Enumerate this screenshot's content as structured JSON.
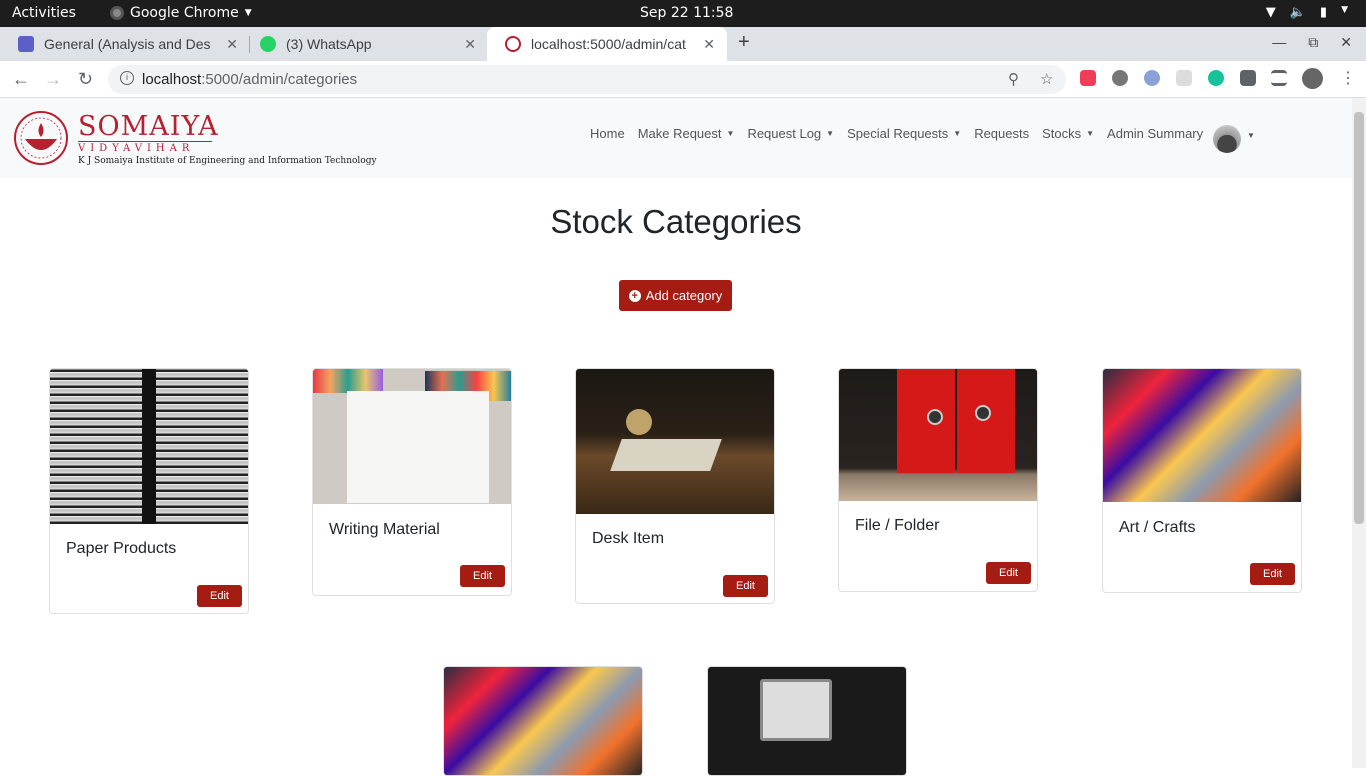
{
  "os": {
    "activities": "Activities",
    "app_name": "Google Chrome",
    "clock": "Sep 22  11:58"
  },
  "browser": {
    "tabs": [
      {
        "title": "General (Analysis and Des",
        "icon": "teams-icon",
        "color": "#5b5fc7"
      },
      {
        "title": "(3) WhatsApp",
        "icon": "whatsapp-icon",
        "color": "#25d366"
      },
      {
        "title": "localhost:5000/admin/cat",
        "icon": "somaiya-favicon",
        "color": "#b7202e"
      }
    ],
    "url_host": "localhost",
    "url_rest": ":5000/admin/categories"
  },
  "navbar": {
    "brand": "SOMAIYA",
    "brand_sub": "VIDYAVIHAR",
    "institute": "K J Somaiya Institute of Engineering and Information Technology",
    "items": [
      {
        "label": "Home",
        "dropdown": false
      },
      {
        "label": "Make Request",
        "dropdown": true
      },
      {
        "label": "Request Log",
        "dropdown": true
      },
      {
        "label": "Special Requests",
        "dropdown": true
      },
      {
        "label": "Requests",
        "dropdown": false
      },
      {
        "label": "Stocks",
        "dropdown": true
      },
      {
        "label": "Admin Summary",
        "dropdown": false
      }
    ]
  },
  "page": {
    "title": "Stock Categories",
    "add_label": "Add category",
    "edit_label": "Edit"
  },
  "categories": [
    {
      "name": "Paper Products"
    },
    {
      "name": "Writing Material"
    },
    {
      "name": "Desk Item"
    },
    {
      "name": "File / Folder"
    },
    {
      "name": "Art / Crafts"
    },
    {
      "name": ""
    },
    {
      "name": ""
    }
  ],
  "colors": {
    "brand": "#b7202e",
    "button": "#a51c12"
  }
}
